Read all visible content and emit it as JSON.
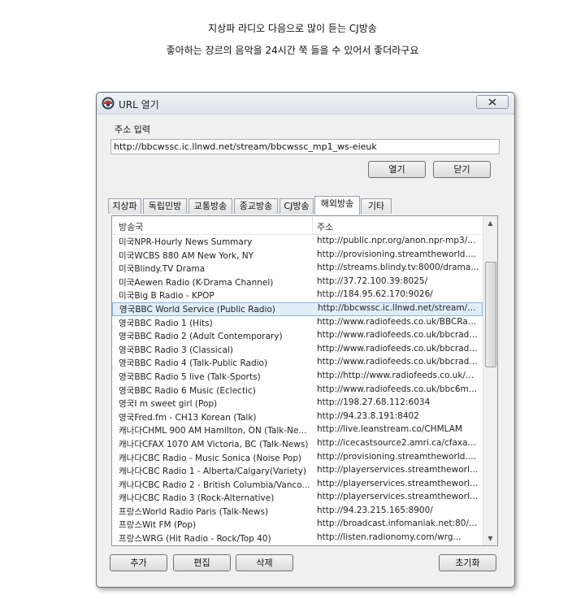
{
  "caption": {
    "line1": "지상파 라디오 다음으로 많이 듣는 CJ방송",
    "line2": "좋아하는 장르의 음악을 24시간 쭉 들을 수 있어서 좋더라구요"
  },
  "dialog": {
    "title": "URL 열기",
    "close_icon": "close-icon",
    "address_label": "주소 입력",
    "url_value": "http://bbcwssc.ic.llnwd.net/stream/bbcwssc_mp1_ws-eieuk",
    "open_label": "열기",
    "close_label": "닫기"
  },
  "tabs": [
    {
      "label": "지상파"
    },
    {
      "label": "독립민방"
    },
    {
      "label": "교통방송"
    },
    {
      "label": "종교방송"
    },
    {
      "label": "CJ방송"
    },
    {
      "label": "해외방송"
    },
    {
      "label": "기타"
    }
  ],
  "active_tab": "해외방송",
  "list": {
    "columns": [
      "방송국",
      "주소"
    ],
    "rows": [
      {
        "name": "미국NPR-Hourly News Summary",
        "url": "http://public.npr.org/anon.npr-mp3/np..."
      },
      {
        "name": "미국WCBS 880 AM New York, NY",
        "url": "http://provisioning.streamtheworld.co..."
      },
      {
        "name": "미국Blindy.TV Drama",
        "url": "http://streams.blindy.tv:8000/drama.m..."
      },
      {
        "name": "미국Aewen Radio (K-Drama Channel)",
        "url": "http://37.72.100.39:8025/"
      },
      {
        "name": "미국Big B Radio - KPOP",
        "url": "http://184.95.62.170:9026/"
      },
      {
        "name": "영국BBC World Service (Public Radio)",
        "url": "http://bbcwssc.ic.llnwd.net/stream/bbc..."
      },
      {
        "name": "영국BBC Radio 1 (Hits)",
        "url": "http://www.radiofeeds.co.uk/BBCRadio..."
      },
      {
        "name": "영국BBC Radio 2 (Adult Contemporary)",
        "url": "http://www.radiofeeds.co.uk/bbcradio..."
      },
      {
        "name": "영국BBC Radio 3 (Classical)",
        "url": "http://www.radiofeeds.co.uk/bbcradio..."
      },
      {
        "name": "영국BBC Radio 4 (Talk-Public Radio)",
        "url": "http://www.radiofeeds.co.uk/bbcradio..."
      },
      {
        "name": "영국BBC Radio 5 live (Talk-Sports)",
        "url": "http://http://www.radiofeeds.co.uk/bbc..."
      },
      {
        "name": "영국BBC Radio 6 Music (Eclectic)",
        "url": "http://www.radiofeeds.co.uk/bbc6musi..."
      },
      {
        "name": "영국I m sweet girl (Pop)",
        "url": "http://198.27.68.112:6034"
      },
      {
        "name": "영국Fred.fm - CH13 Korean (Talk)",
        "url": "http://94.23.8.191:8402"
      },
      {
        "name": "캐나다CHML 900 AM Hamilton, ON (Talk-Ne...",
        "url": "http://live.leanstream.co/CHMLAM"
      },
      {
        "name": "캐나다CFAX 1070 AM Victoria, BC (Talk-News)",
        "url": "http://icecastsource2.amri.ca/cfaxam-..."
      },
      {
        "name": "캐나다CBC Radio - Music Sonica (Noise Pop)",
        "url": "http://provisioning.streamtheworld.co..."
      },
      {
        "name": "캐나다CBC Radio 1 - Alberta/Calgary(Variety)",
        "url": "http://playerservices.streamtheworld.c..."
      },
      {
        "name": "캐나다CBC Radio 2 - British Columbia/Vanco...",
        "url": "http://playerservices.streamtheworld.c..."
      },
      {
        "name": "캐나다CBC Radio 3 (Rock-Alternative)",
        "url": "http://playerservices.streamtheworld.c..."
      },
      {
        "name": "프랑스World Radio Paris (Talk-News)",
        "url": "http://94.23.215.165:8900/"
      },
      {
        "name": "프랑스Wit FM (Pop)",
        "url": "http://broadcast.infomaniak.net:80/sta..."
      },
      {
        "name": "프랑스WRG (Hit Radio - Rock/Top 40)",
        "url": "http://listen.radionomy.com/wrg..."
      }
    ],
    "selected_index": 5
  },
  "footer": {
    "add_label": "추가",
    "edit_label": "편집",
    "delete_label": "삭제",
    "reset_label": "초기화"
  },
  "colors": {
    "selection_bg": "#dfeefb",
    "selection_border": "#88b6e4",
    "window_bg": "#f0f0f0"
  }
}
